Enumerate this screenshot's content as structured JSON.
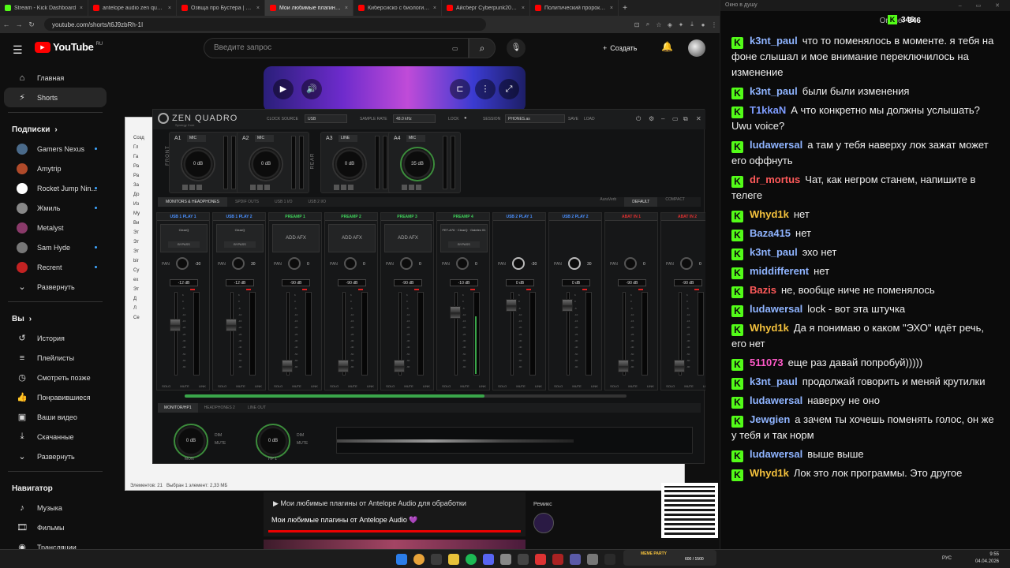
{
  "browser": {
    "tabs": [
      {
        "title": "Stream - Kick Dashboard",
        "color": "#53fc18",
        "active": false
      },
      {
        "title": "antelope audio zen quadro – ",
        "color": "#ff0000",
        "active": false
      },
      {
        "title": "Озвща про Бустера | #оли",
        "color": "#ff0000",
        "active": false
      },
      {
        "title": "Мои любимые плагины от ",
        "color": "#ff0000",
        "active": true
      },
      {
        "title": "Киберсиско с биологичес",
        "color": "#ff0000",
        "active": false
      },
      {
        "title": "Айсберг Cyberpunk2077 – ",
        "color": "#ff0000",
        "active": false
      },
      {
        "title": "Политический пророк пр",
        "color": "#ff0000",
        "active": false
      }
    ],
    "url": "youtube.com/shorts/t6J9zbRh-1I"
  },
  "youtube": {
    "logo": "YouTube",
    "region": "RU",
    "search_placeholder": "Введите запрос",
    "create_label": "Создать",
    "nav_main": [
      {
        "label": "Главная",
        "icon": "home-icon"
      },
      {
        "label": "Shorts",
        "icon": "shorts-icon"
      }
    ],
    "subs_title": "Подписки",
    "subs": [
      {
        "label": "Gamers Nexus",
        "color": "#4a6a8a",
        "dot": true
      },
      {
        "label": "Amytrip",
        "color": "#b04a2a",
        "dot": false
      },
      {
        "label": "Rocket Jump Nin...",
        "color": "#ffffff",
        "dot": true
      },
      {
        "label": "Жмиль",
        "color": "#888888",
        "dot": true
      },
      {
        "label": "Metalyst",
        "color": "#8a3a6a",
        "dot": false
      },
      {
        "label": "Sam Hyde",
        "color": "#777777",
        "dot": true
      },
      {
        "label": "Recrent",
        "color": "#c22222",
        "dot": true
      }
    ],
    "expand_label": "Развернуть",
    "you_title": "Вы",
    "you_items": [
      {
        "label": "История",
        "icon": "history-icon"
      },
      {
        "label": "Плейлисты",
        "icon": "playlist-icon"
      },
      {
        "label": "Смотреть позже",
        "icon": "clock-icon"
      },
      {
        "label": "Понравившиеся",
        "icon": "like-icon"
      },
      {
        "label": "Ваши видео",
        "icon": "video-icon"
      },
      {
        "label": "Скачанные",
        "icon": "download-icon"
      }
    ],
    "you_expand": "Развернуть",
    "nav_title": "Навигатор",
    "nav_items": [
      {
        "label": "Музыка",
        "icon": "music-icon"
      },
      {
        "label": "Фильмы",
        "icon": "film-icon"
      },
      {
        "label": "Трансляции",
        "icon": "live-icon"
      }
    ],
    "now_playing_line1": "Мои любимые плагины от Antelope Audio для обработки",
    "now_playing_line2": "Мои любимые плагины от Antelope Audio 💜",
    "remix_label": "Ремикс"
  },
  "explorer": {
    "status_items": "Элементов: 21",
    "status_selected": "Выбран 1 элемент: 2,33 МБ",
    "rows": [
      "Созд",
      "Гл",
      "Га",
      "Ра",
      "Ра",
      "За",
      "До",
      "Из",
      "Му",
      "Ви",
      "Эт",
      "Эт",
      "Эт",
      "bir",
      "Су",
      "ex",
      "Эт",
      "Д",
      "Л",
      "Се"
    ]
  },
  "zen": {
    "brand": "ZEN QUADRO",
    "brand_sub": "Synergy Core",
    "clock_source_label": "CLOCK SOURCE",
    "clock_source": "USB",
    "sample_rate_label": "SAMPLE RATE",
    "sample_rate": "48.0 kHz",
    "lock_label": "LOCK",
    "session_label": "SESSION",
    "session": "PHONES.as",
    "save_label": "SAVE",
    "load_label": "LOAD",
    "front_label": "FRONT",
    "rear_label": "REAR",
    "inputs": [
      {
        "id": "A1",
        "mode": "MIC",
        "gain": "0 dB",
        "green": false
      },
      {
        "id": "A2",
        "mode": "MIC",
        "gain": "0 dB",
        "green": false
      },
      {
        "id": "A3",
        "mode": "LINE",
        "gain": "0 dB",
        "green": false
      },
      {
        "id": "A4",
        "mode": "MIC",
        "gain": "35 dB",
        "green": true
      }
    ],
    "mixer_tabs": [
      "MONITORS & HEADPHONES",
      "SPDIF OUTS",
      "USB 1 I/O",
      "USB 2 I/O"
    ],
    "auraverb": "AuraVerb",
    "view_default": "DEFAULT",
    "view_compact": "COMPACT",
    "channels": [
      {
        "name": "USB 1 PLAY 1",
        "color": "#4a90ff",
        "afx": "ClearQ",
        "bypass": "BYPASS",
        "pan": "-30",
        "gain": "-12 dB",
        "fader_pct": 0.38,
        "vu_pct": 0.0,
        "panhi": false
      },
      {
        "name": "USB 1 PLAY 2",
        "color": "#4a90ff",
        "afx": "ClearQ",
        "bypass": "BYPASS",
        "pan": "30",
        "gain": "-12 dB",
        "fader_pct": 0.38,
        "vu_pct": 0.0,
        "panhi": false
      },
      {
        "name": "PREAMP 1",
        "color": "#3fd05a",
        "afx": "ADD AFX",
        "bypass": "",
        "pan": "0",
        "gain": "-90 dB",
        "fader_pct": 0.95,
        "vu_pct": 0.0,
        "panhi": false
      },
      {
        "name": "PREAMP 2",
        "color": "#3fd05a",
        "afx": "ADD AFX",
        "bypass": "",
        "pan": "0",
        "gain": "-90 dB",
        "fader_pct": 0.95,
        "vu_pct": 0.0,
        "panhi": false
      },
      {
        "name": "PREAMP 3",
        "color": "#3fd05a",
        "afx": "ADD AFX",
        "bypass": "",
        "pan": "0",
        "gain": "-90 dB",
        "fader_pct": 0.95,
        "vu_pct": 0.0,
        "panhi": false
      },
      {
        "name": "PREAMP 4",
        "color": "#3fd05a",
        "afx": "FET-A76 · ClearQ · Gatelex 01",
        "bypass": "BYPASS",
        "pan": "0",
        "gain": "-10 dB",
        "fader_pct": 0.2,
        "vu_pct": 0.7,
        "panhi": false
      },
      {
        "name": "USB 2 PLAY 1",
        "color": "#4a90ff",
        "afx": "",
        "bypass": "",
        "pan": "-30",
        "gain": "0 dB",
        "fader_pct": 0.1,
        "vu_pct": 0.0,
        "panhi": true
      },
      {
        "name": "USB 2 PLAY 2",
        "color": "#4a90ff",
        "afx": "",
        "bypass": "",
        "pan": "30",
        "gain": "0 dB",
        "fader_pct": 0.1,
        "vu_pct": 0.0,
        "panhi": true
      },
      {
        "name": "ABAT IN 1",
        "color": "#e03030",
        "afx": "",
        "bypass": "",
        "pan": "0",
        "gain": "-90 dB",
        "fader_pct": 0.95,
        "vu_pct": 0.0,
        "panhi": false
      },
      {
        "name": "ABAT IN 2",
        "color": "#e03030",
        "afx": "",
        "bypass": "",
        "pan": "0",
        "gain": "-90 dB",
        "fader_pct": 0.95,
        "vu_pct": 0.0,
        "panhi": false
      }
    ],
    "pan_label": "PAN",
    "solo": "SOLO",
    "mute": "MUTE",
    "link": "LINK",
    "monitor_tabs": [
      "MONITOR/HP1",
      "HEADPHONES 2",
      "LINE OUT"
    ],
    "mon_gain": "0 dB",
    "mon_label": "MON",
    "hp_gain": "0 dB",
    "hp_label": "HP 1",
    "dim": "DIM",
    "mono": "MUTE"
  },
  "chat": {
    "window_title": "Окно в душу",
    "online_label": "Online:",
    "online_count": "346",
    "kick_count": "346",
    "messages": [
      {
        "user": "k3nt_paul",
        "color": "#8fb4ff",
        "text": "что то поменялось в моменте. я тебя на фоне слышал и мое внимание переключилось на изменение"
      },
      {
        "user": "k3nt_paul",
        "color": "#8fb4ff",
        "text": "были были изменения"
      },
      {
        "user": "T1kkaN",
        "color": "#7e9cff",
        "text": "А что конкретно мы должны услышать? Uwu voice?"
      },
      {
        "user": "ludawersal",
        "color": "#8fb4ff",
        "text": "а там у тебя наверху лок зажат может его оффнуть"
      },
      {
        "user": "dr_mortus",
        "color": "#ff5a5a",
        "text": "Чат, как негром станем, напишите в телеге"
      },
      {
        "user": "Whyd1k",
        "color": "#f5c23d",
        "text": "нет"
      },
      {
        "user": "Baza415",
        "color": "#8fb4ff",
        "text": "нет"
      },
      {
        "user": "k3nt_paul",
        "color": "#8fb4ff",
        "text": "эхо нет"
      },
      {
        "user": "middifferent",
        "color": "#8fb4ff",
        "text": "нет"
      },
      {
        "user": "Bazis",
        "color": "#ff5a5a",
        "text": "не, вообще ниче не поменялось"
      },
      {
        "user": "ludawersal",
        "color": "#8fb4ff",
        "text": "lock - вот эта штучка"
      },
      {
        "user": "Whyd1k",
        "color": "#f5c23d",
        "text": "Да я понимаю о каком \"ЭХО\" идёт речь, его нет"
      },
      {
        "user": "511073",
        "color": "#ff5ac8",
        "text": "еще раз давай попробуй)))))"
      },
      {
        "user": "k3nt_paul",
        "color": "#8fb4ff",
        "text": "продолжай говорить и меняй крутилки"
      },
      {
        "user": "ludawersal",
        "color": "#8fb4ff",
        "text": "наверху не оно"
      },
      {
        "user": "Jewgien",
        "color": "#8fb4ff",
        "text": "а зачем ты хочешь поменять голос, он же у тебя и так норм"
      },
      {
        "user": "ludawersal",
        "color": "#8fb4ff",
        "text": "выше выше"
      },
      {
        "user": "Whyd1k",
        "color": "#f5c23d",
        "text": "Лок это лок программы. Это другое"
      }
    ]
  },
  "taskbar": {
    "lang": "РУС",
    "time": "9:55",
    "date": "04.04.2026",
    "game_title": "MEME PARTY",
    "game_score": "600 / 1500"
  }
}
